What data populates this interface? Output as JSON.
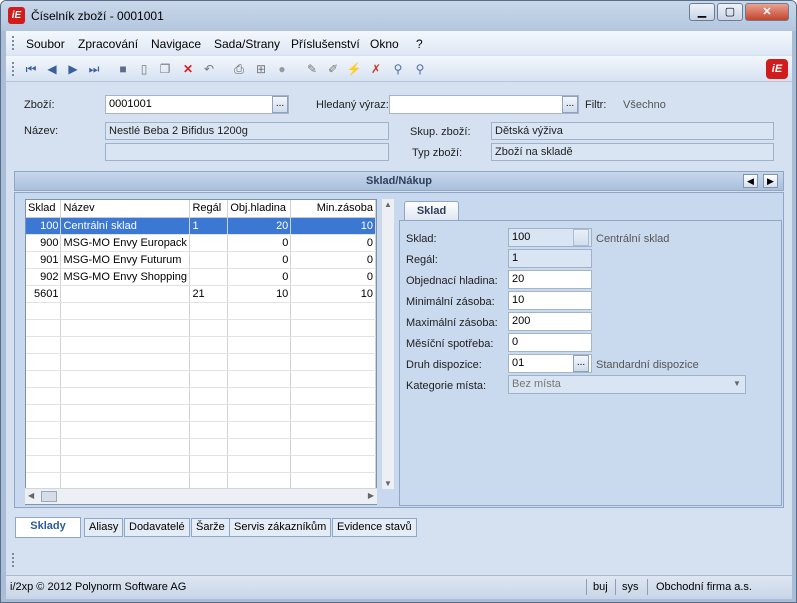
{
  "window": {
    "title": "Číselník zboží - 0001001",
    "app_icon": "iE",
    "minimize": "▁",
    "maximize": "▢",
    "close": "✕"
  },
  "menu": [
    "Soubor",
    "Zpracování",
    "Navigace",
    "Sada/Strany",
    "Příslušenství",
    "Okno",
    "?"
  ],
  "toolbar_icons": [
    "first-icon",
    "prev-icon",
    "next-icon",
    "last-icon",
    "save-icon",
    "new-icon",
    "copy-icon",
    "delete-icon",
    "undo-icon",
    "print-icon",
    "tree-icon",
    "refresh-icon",
    "edit-icon",
    "erase-icon",
    "filter-icon",
    "clear-filter-icon",
    "search-icon",
    "find-icon"
  ],
  "header": {
    "zbozi_label": "Zboží:",
    "zbozi_value": "0001001",
    "hledany_label": "Hledaný výraz:",
    "hledany_value": "",
    "filtr_label": "Filtr:",
    "filtr_value": "Všechno",
    "nazev_label": "Název:",
    "nazev_value": "Nestlé Beba 2 Bifidus 1200g",
    "nazev_value2": "",
    "skup_label": "Skup. zboží:",
    "skup_value": "Dětská výživa",
    "typ_label": "Typ zboží:",
    "typ_value": "Zboží na skladě"
  },
  "panel_title": "Sklad/Nákup",
  "grid": {
    "columns": [
      "Sklad",
      "Název",
      "Regál",
      "Obj.hladina",
      "Min.zásoba"
    ],
    "rows": [
      {
        "sklad": "100",
        "nazev": "Centrální sklad",
        "regal": "1",
        "obj": "20",
        "min": "10"
      },
      {
        "sklad": "900",
        "nazev": "MSG-MO Envy Europack",
        "regal": "",
        "obj": "0",
        "min": "0"
      },
      {
        "sklad": "901",
        "nazev": "MSG-MO Envy Futurum",
        "regal": "",
        "obj": "0",
        "min": "0"
      },
      {
        "sklad": "902",
        "nazev": "MSG-MO Envy Shopping",
        "regal": "",
        "obj": "0",
        "min": "0"
      },
      {
        "sklad": "5601",
        "nazev": "",
        "regal": "21",
        "obj": "10",
        "min": "10"
      }
    ]
  },
  "detail": {
    "tab": "Sklad",
    "sklad_label": "Sklad:",
    "sklad_value": "100",
    "sklad_name": "Centrální sklad",
    "regal_label": "Regál:",
    "regal_value": "1",
    "obj_label": "Objednací hladina:",
    "obj_value": "20",
    "min_label": "Minimální zásoba:",
    "min_value": "10",
    "max_label": "Maximální zásoba:",
    "max_value": "200",
    "mes_label": "Měsíční spotřeba:",
    "mes_value": "0",
    "druh_label": "Druh dispozice:",
    "druh_value": "01",
    "druh_name": "Standardní dispozice",
    "kat_label": "Kategorie místa:",
    "kat_value": "Bez místa"
  },
  "bottom_tabs": [
    "Sklady",
    "Aliasy",
    "Dodavatelé",
    "Šarže",
    "Servis zákazníkům",
    "Evidence stavů"
  ],
  "status": {
    "copyright": "i/2xp © 2012 Polynorm Software AG",
    "user": "buj",
    "db": "sys",
    "firm": "Obchodní firma a.s."
  }
}
